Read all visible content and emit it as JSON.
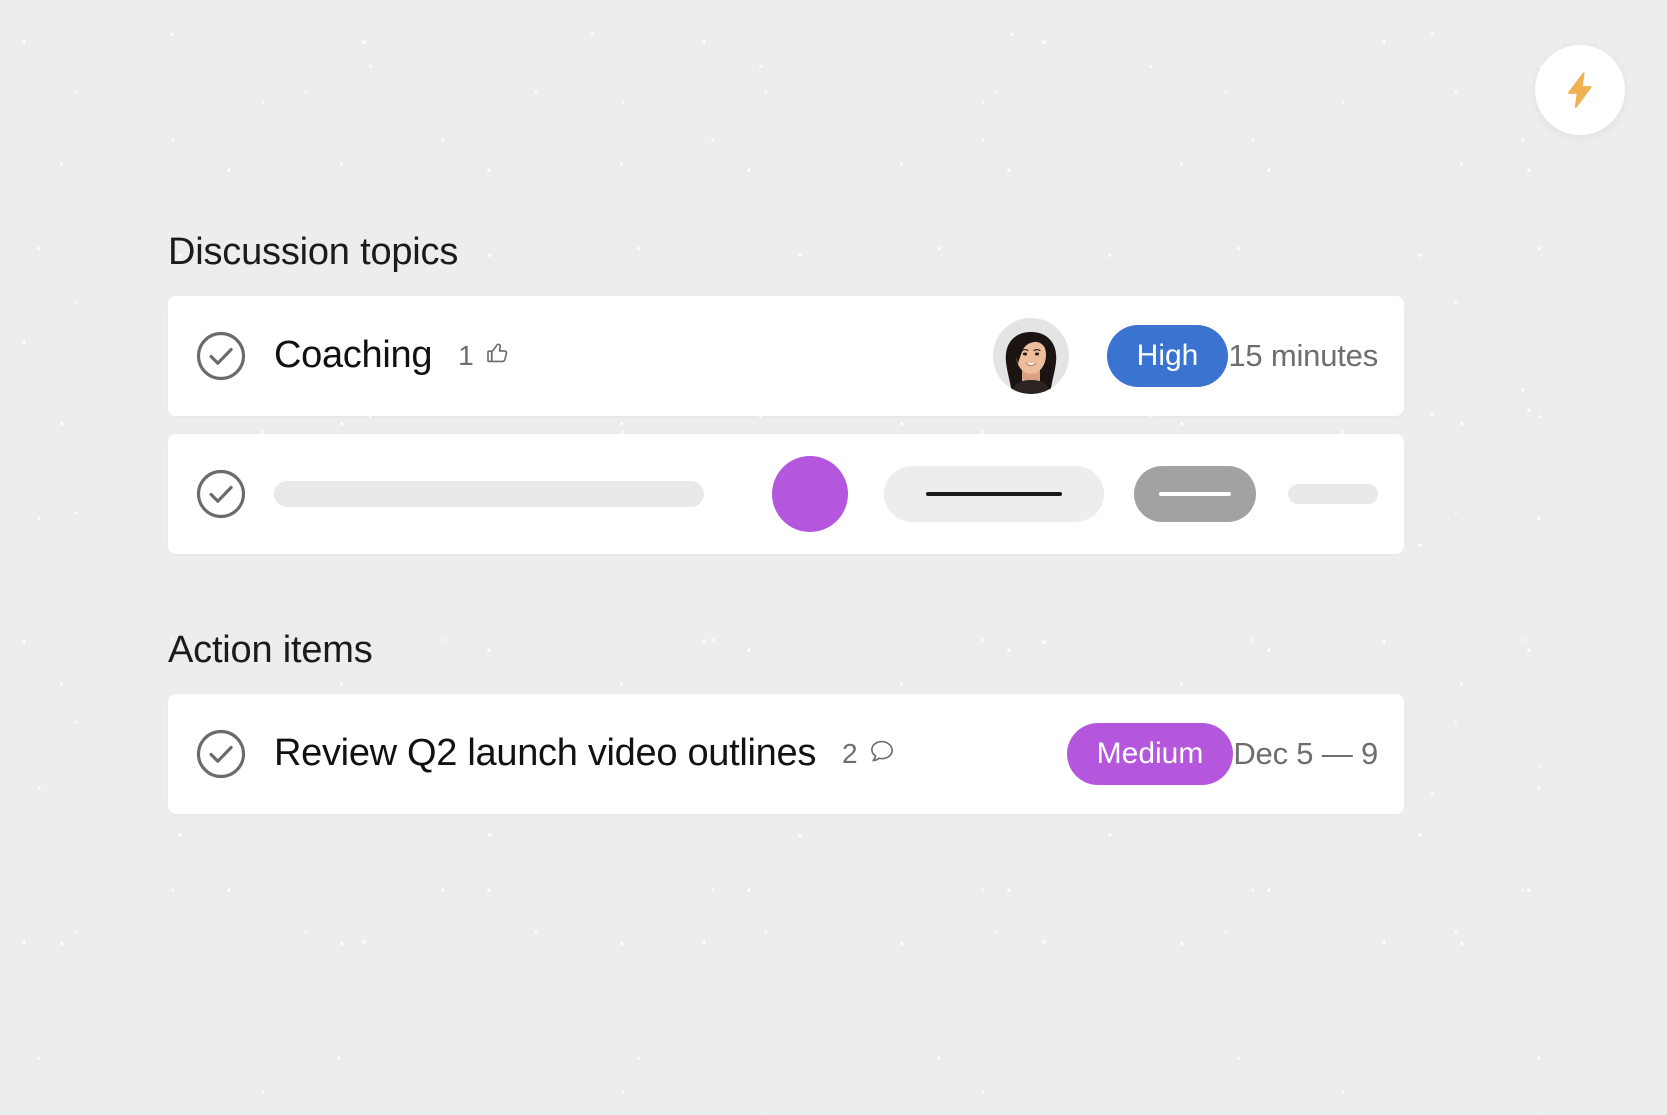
{
  "fab": {
    "icon": "lightning-bolt-icon",
    "color": "#efb152"
  },
  "sections": [
    {
      "heading": "Discussion topics",
      "rows": [
        {
          "kind": "filled",
          "status_icon": "check-circle-icon",
          "title": "Coaching",
          "reaction_count": "1",
          "reaction_icon": "thumbs-up-icon",
          "avatar": "user-avatar",
          "badge_label": "High",
          "badge_color": "#3a74d0",
          "meta": "15 minutes"
        },
        {
          "kind": "skeleton",
          "status_icon": "check-circle-icon",
          "avatar_color": "#b457dd",
          "pill_light_color": "#ededed",
          "pill_dark_color": "#a2a2a2"
        }
      ]
    },
    {
      "heading": "Action items",
      "rows": [
        {
          "kind": "filled",
          "status_icon": "check-circle-icon",
          "title": "Review Q2 launch video outlines",
          "reaction_count": "2",
          "reaction_icon": "comment-bubble-icon",
          "badge_label": "Medium",
          "badge_color": "#b457dd",
          "meta": "Dec 5 — 9"
        }
      ]
    }
  ],
  "colors": {
    "background": "#eceded",
    "card": "#ffffff",
    "text_primary": "#111111",
    "text_muted": "#6e6e6e",
    "accent_blue": "#3a74d0",
    "accent_purple": "#b457dd",
    "accent_amber": "#efb152"
  }
}
